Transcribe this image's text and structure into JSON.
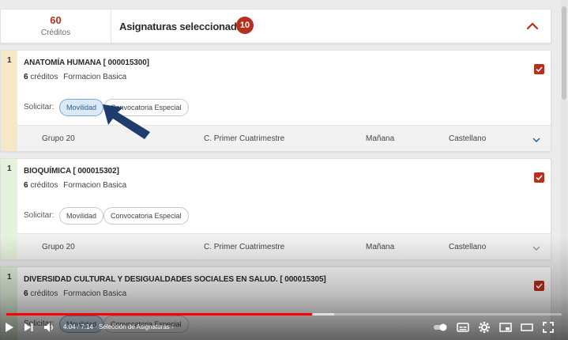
{
  "header": {
    "credits_value": "60",
    "credits_label": "Créditos",
    "title": "Asignaturas seleccionadas",
    "count": "10"
  },
  "subjects": [
    {
      "order": "1",
      "name": "ANATOMÍA HUMANA [ 000015300]",
      "credits": "6",
      "credits_unit": "créditos",
      "type": "Formacion Basica",
      "stripe_color": "#f6e7c7",
      "request_label": "Solicitar:",
      "chips": [
        "Movilidad",
        "Convocatoria Especial"
      ],
      "chips_active": [
        true,
        false
      ],
      "group": {
        "name": "Grupo 20",
        "period": "C. Primer Cuatrimestre",
        "shift": "Mañana",
        "language": "Castellano"
      },
      "selected": true
    },
    {
      "order": "1",
      "name": "BIOQUÍMICA [ 000015302]",
      "credits": "6",
      "credits_unit": "créditos",
      "type": "Formacion Basica",
      "stripe_color": "#e3f2dc",
      "request_label": "Solicitar:",
      "chips": [
        "Movilidad",
        "Convocatoria Especial"
      ],
      "chips_active": [
        false,
        false
      ],
      "group": {
        "name": "Grupo 20",
        "period": "C. Primer Cuatrimestre",
        "shift": "Mañana",
        "language": "Castellano"
      },
      "selected": true
    },
    {
      "order": "1",
      "name": "DIVERSIDAD CULTURAL Y DESIGUALDADES SOCIALES EN SALUD. [ 000015305]",
      "credits": "6",
      "credits_unit": "créditos",
      "type": "Formacion Basica",
      "stripe_color": "#e3f2dc",
      "request_label": "Solicitar:",
      "chips": [
        "Movilidad",
        "Convocatoria Especial"
      ],
      "chips_active": [
        true,
        false
      ],
      "selected": true
    }
  ],
  "player": {
    "time_current": "4:04",
    "time_total": "7:14",
    "chapter": "Selección de Asignaturas",
    "progress": 0.55,
    "buffered_end": 0.59
  },
  "colors": {
    "accent": "#b5301f",
    "arrow": "#1e3d6e",
    "progress": "#ff0000"
  }
}
